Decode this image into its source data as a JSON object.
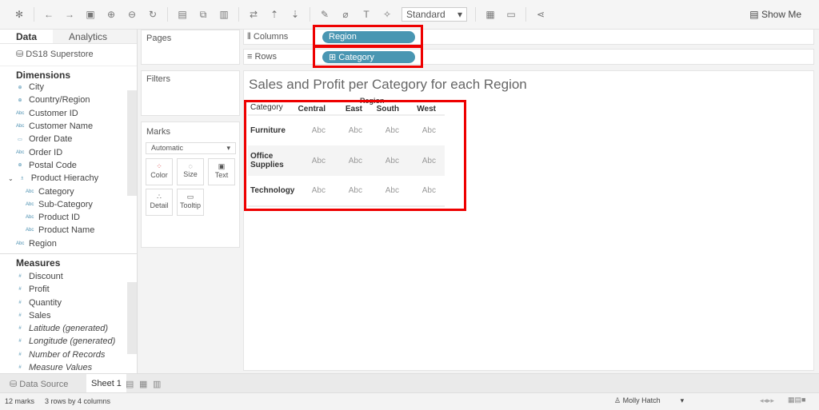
{
  "toolbar": {
    "view_mode": "Standard",
    "show_me": "Show Me"
  },
  "data_pane": {
    "tab_data": "Data",
    "tab_analytics": "Analytics",
    "datasource": "DS18 Superstore",
    "dimensions_title": "Dimensions",
    "dimensions": [
      {
        "label": "City",
        "icon": "globe"
      },
      {
        "label": "Country/Region",
        "icon": "globe"
      },
      {
        "label": "Customer ID",
        "icon": "Abc"
      },
      {
        "label": "Customer Name",
        "icon": "Abc"
      },
      {
        "label": "Order Date",
        "icon": "calendar"
      },
      {
        "label": "Order ID",
        "icon": "Abc"
      },
      {
        "label": "Postal Code",
        "icon": "globe"
      },
      {
        "label": "Product Hierachy",
        "icon": "hierarchy"
      },
      {
        "label": "Category",
        "icon": "Abc"
      },
      {
        "label": "Sub-Category",
        "icon": "Abc"
      },
      {
        "label": "Product ID",
        "icon": "Abc"
      },
      {
        "label": "Product Name",
        "icon": "Abc"
      },
      {
        "label": "Region",
        "icon": "Abc"
      }
    ],
    "measures_title": "Measures",
    "measures": [
      "Discount",
      "Profit",
      "Quantity",
      "Sales",
      "Latitude (generated)",
      "Longitude (generated)",
      "Number of Records",
      "Measure Values"
    ]
  },
  "cards": {
    "pages": "Pages",
    "filters": "Filters",
    "marks": "Marks",
    "mark_type": "Automatic",
    "color": "Color",
    "size": "Size",
    "text": "Text",
    "detail": "Detail",
    "tooltip": "Tooltip"
  },
  "shelves": {
    "columns_label": "Columns",
    "columns_pill": "Region",
    "rows_label": "Rows",
    "rows_pill": "Category"
  },
  "view": {
    "title": "Sales and Profit per Category for each Region",
    "region_header": "Region",
    "category_header": "Category",
    "columns": [
      "Central",
      "East",
      "South",
      "West"
    ],
    "rows": [
      {
        "label": "Furniture",
        "cells": [
          "Abc",
          "Abc",
          "Abc",
          "Abc"
        ]
      },
      {
        "label": "Office Supplies",
        "cells": [
          "Abc",
          "Abc",
          "Abc",
          "Abc"
        ]
      },
      {
        "label": "Technology",
        "cells": [
          "Abc",
          "Abc",
          "Abc",
          "Abc"
        ]
      }
    ]
  },
  "sheet_tabs": {
    "data_source": "Data Source",
    "sheet": "Sheet 1"
  },
  "status": {
    "marks": "12 marks",
    "dims": "3 rows by 4 columns",
    "user": "Molly Hatch"
  }
}
